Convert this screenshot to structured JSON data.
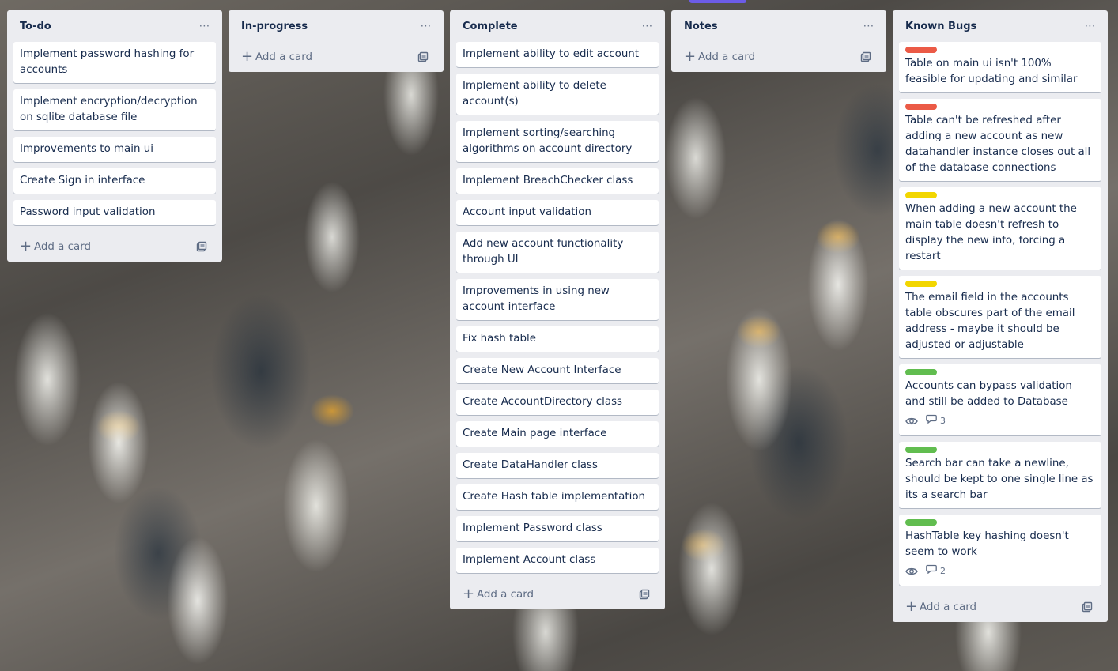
{
  "colors": {
    "label_red": "#eb5a46",
    "label_yellow": "#f2d600",
    "label_green": "#61bd4f",
    "list_bg": "#ebecf0"
  },
  "icons": {
    "menu": "ellipsis-icon",
    "add": "plus-icon",
    "template": "card-template-icon",
    "watch": "eye-icon",
    "comments": "comment-icon"
  },
  "add_card_label": "Add a card",
  "lists": [
    {
      "title": "To-do",
      "cards": [
        {
          "text": "Implement password hashing for accounts"
        },
        {
          "text": "Implement encryption/decryption on sqlite database file"
        },
        {
          "text": "Improvements to main ui"
        },
        {
          "text": "Create Sign in interface"
        },
        {
          "text": "Password input validation"
        }
      ]
    },
    {
      "title": "In-progress",
      "cards": []
    },
    {
      "title": "Complete",
      "cards": [
        {
          "text": "Implement ability to edit account"
        },
        {
          "text": "Implement ability to delete account(s)"
        },
        {
          "text": "Implement sorting/searching algorithms on account directory"
        },
        {
          "text": "Implement BreachChecker class"
        },
        {
          "text": "Account input validation"
        },
        {
          "text": "Add new account functionality through UI"
        },
        {
          "text": "Improvements in using new account interface"
        },
        {
          "text": "Fix hash table"
        },
        {
          "text": "Create New Account Interface"
        },
        {
          "text": "Create AccountDirectory class"
        },
        {
          "text": "Create Main page interface"
        },
        {
          "text": "Create DataHandler class"
        },
        {
          "text": "Create Hash table implementation"
        },
        {
          "text": "Implement Password class"
        },
        {
          "text": "Implement Account class"
        }
      ]
    },
    {
      "title": "Notes",
      "cards": []
    },
    {
      "title": "Known Bugs",
      "cards": [
        {
          "text": "Table on main ui isn't 100% feasible for updating and similar",
          "label": "red"
        },
        {
          "text": "Table can't be refreshed after adding a new account as new datahandler instance closes out all of the database connections",
          "label": "red"
        },
        {
          "text": "When adding a new account the main table doesn't refresh to display the new info, forcing a restart",
          "label": "yellow"
        },
        {
          "text": "The email field in the accounts table obscures part of the email address - maybe it should be adjusted or adjustable",
          "label": "yellow"
        },
        {
          "text": "Accounts can bypass validation and still be added to Database",
          "label": "green",
          "watching": true,
          "comments": "3"
        },
        {
          "text": "Search bar can take a newline, should be kept to one single line as its a search bar",
          "label": "green"
        },
        {
          "text": "HashTable key hashing doesn't seem to work",
          "label": "green",
          "watching": true,
          "comments": "2"
        }
      ]
    }
  ]
}
